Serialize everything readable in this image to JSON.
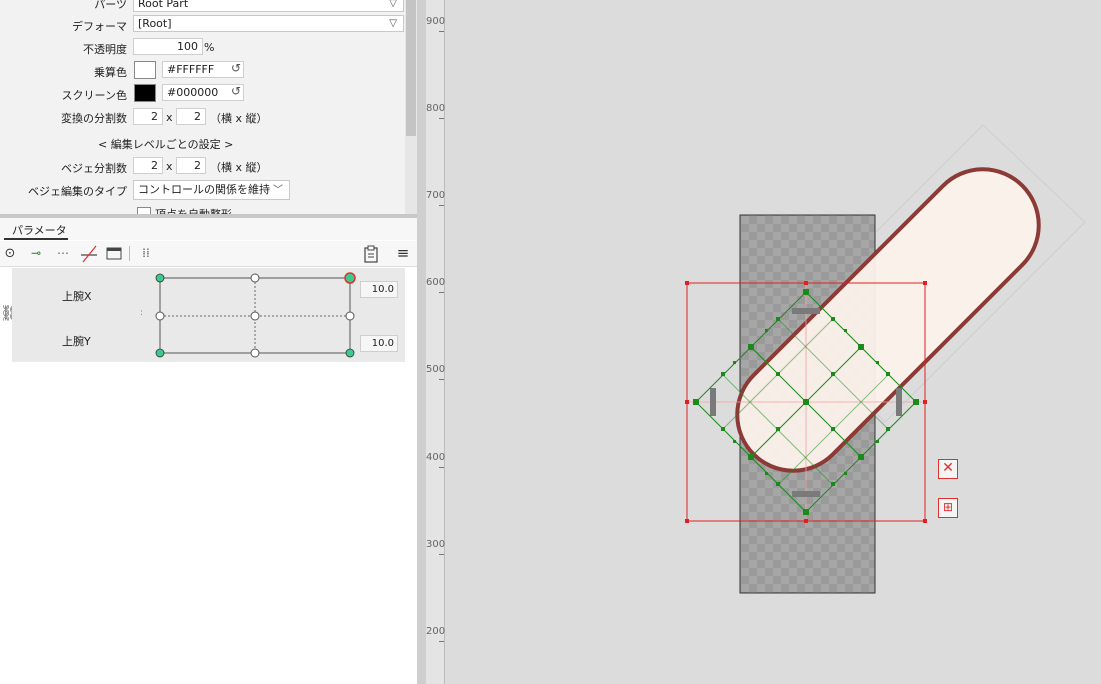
{
  "properties": {
    "parts": {
      "label": "パーツ",
      "value": "Root Part"
    },
    "deformer": {
      "label": "デフォーマ",
      "value": "[Root]"
    },
    "opacity": {
      "label": "不透明度",
      "value": "100",
      "unit": "%"
    },
    "multiply_color": {
      "label": "乗算色",
      "value": "#FFFFFF",
      "swatch": "#ffffff"
    },
    "screen_color": {
      "label": "スクリーン色",
      "value": "#000000",
      "swatch": "#000000"
    },
    "transform_div": {
      "label": "変換の分割数",
      "a": "2",
      "x": "x",
      "b": "2",
      "note": "（横 x 縦）"
    },
    "edit_level_heading": "< 編集レベルごとの設定 >",
    "bezier_div": {
      "label": "ベジェ分割数",
      "a": "2",
      "x": "x",
      "b": "2",
      "note": "（横 x 縦）"
    },
    "bezier_edit_type": {
      "label": "ベジェ編集のタイプ",
      "value": "コントロールの関係を維持"
    },
    "auto_deform": {
      "label": "頂点を自動整形"
    }
  },
  "parameters": {
    "tab_label": "パラメータ",
    "rows": [
      {
        "name": "上腕X",
        "value": "10.0"
      },
      {
        "name": "上腕Y",
        "value": "10.0"
      }
    ]
  },
  "toolbar_icons": [
    "expand-icon",
    "add-key-icon",
    "add-keys-icon",
    "delete-key-icon",
    "keyform-icon",
    "grid-icon",
    "clipboard-icon",
    "menu-icon"
  ],
  "ruler": {
    "ticks": [
      "900",
      "800",
      "700",
      "600",
      "500",
      "400",
      "300",
      "200"
    ]
  },
  "colors": {
    "warp_green": "#1a8a1a",
    "select_red": "#e02020",
    "stroke": "#8b3a36",
    "fill": "#fbf1eb"
  }
}
